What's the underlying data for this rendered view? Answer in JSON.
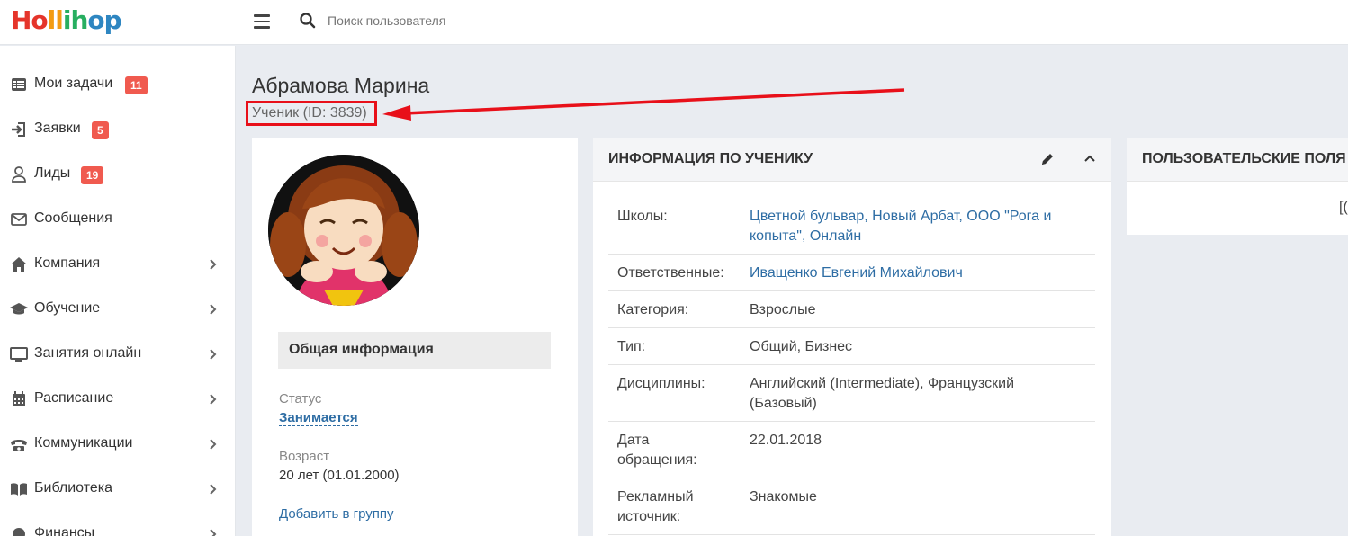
{
  "app": {
    "logo": {
      "p1": "Ho",
      "p2": "ll",
      "p3": "ih",
      "p4": "op"
    },
    "search_placeholder": "Поиск пользователя"
  },
  "sidebar": {
    "items": [
      {
        "label": "Мои задачи",
        "badge": "11",
        "icon": "list-icon"
      },
      {
        "label": "Заявки",
        "badge": "5",
        "icon": "sign-in-icon"
      },
      {
        "label": "Лиды",
        "badge": "19",
        "icon": "user-icon"
      },
      {
        "label": "Сообщения",
        "icon": "envelope-icon"
      },
      {
        "label": "Компания",
        "icon": "home-icon"
      },
      {
        "label": "Обучение",
        "icon": "graduation-cap-icon"
      },
      {
        "label": "Занятия онлайн",
        "icon": "monitor-icon"
      },
      {
        "label": "Расписание",
        "icon": "calendar-icon"
      },
      {
        "label": "Коммуникации",
        "icon": "phone-icon"
      },
      {
        "label": "Библиотека",
        "icon": "book-icon"
      },
      {
        "label": "Финансы",
        "icon": "wallet-icon"
      }
    ]
  },
  "page": {
    "title": "Абрамова Марина",
    "subtitle": "Ученик (ID: 3839)"
  },
  "profile": {
    "section_title": "Общая информация",
    "status_label": "Статус",
    "status_value": "Занимается",
    "age_label": "Возраст",
    "age_value": "20 лет (01.01.2000)",
    "add_group": "Добавить в группу"
  },
  "info": {
    "title": "ИНФОРМАЦИЯ ПО УЧЕНИКУ",
    "rows": [
      {
        "key": "Школы:",
        "value": "Цветной бульвар, Новый Арбат, ООО \"Рога и копыта\", Онлайн"
      },
      {
        "key": "Ответственные:",
        "value": "Иващенко Евгений Михайлович"
      },
      {
        "key": "Категория:",
        "value": "Взрослые"
      },
      {
        "key": "Тип:",
        "value": "Общий, Бизнес"
      },
      {
        "key": "Дисциплины:",
        "value": "Английский (Intermediate), Французский (Базовый)"
      },
      {
        "key": "Дата обращения:",
        "value": "22.01.2018"
      },
      {
        "key": "Рекламный источник:",
        "value": "Знакомые"
      }
    ]
  },
  "custom_fields": {
    "title": "ПОЛЬЗОВАТЕЛЬСКИЕ ПОЛЯ",
    "partial": "[("
  },
  "colors": {
    "accent_link": "#2e6da4",
    "badge": "#f05a4f",
    "highlight": "#e8101a"
  }
}
